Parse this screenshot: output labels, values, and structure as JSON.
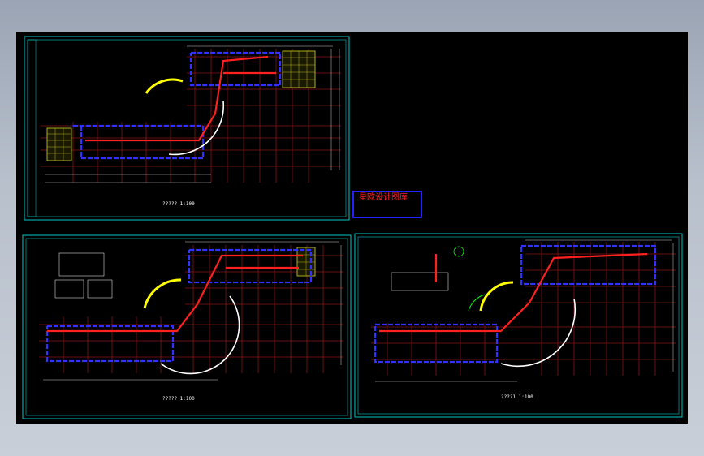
{
  "stamp": {
    "title": "星欧设计图库",
    "line2": "",
    "line3": "",
    "line4": ""
  },
  "sheets": {
    "top": {
      "caption": "?????  1:100"
    },
    "bottom_left": {
      "caption": "?????  1:100"
    },
    "bottom_right": {
      "caption": "????1  1:100"
    }
  },
  "colors": {
    "background": "#9aa4b4",
    "canvas": "#000000",
    "frame": "#00c8c8",
    "walls_red": "#ff2020",
    "walls_blue": "#3030ff",
    "grid_red": "#c81e1e",
    "hatch_yellow": "#d4d420",
    "door_green": "#00ff00",
    "dim_white": "#ffffff",
    "stamp_border": "#2222ff",
    "stamp_text": "#ff2222"
  }
}
